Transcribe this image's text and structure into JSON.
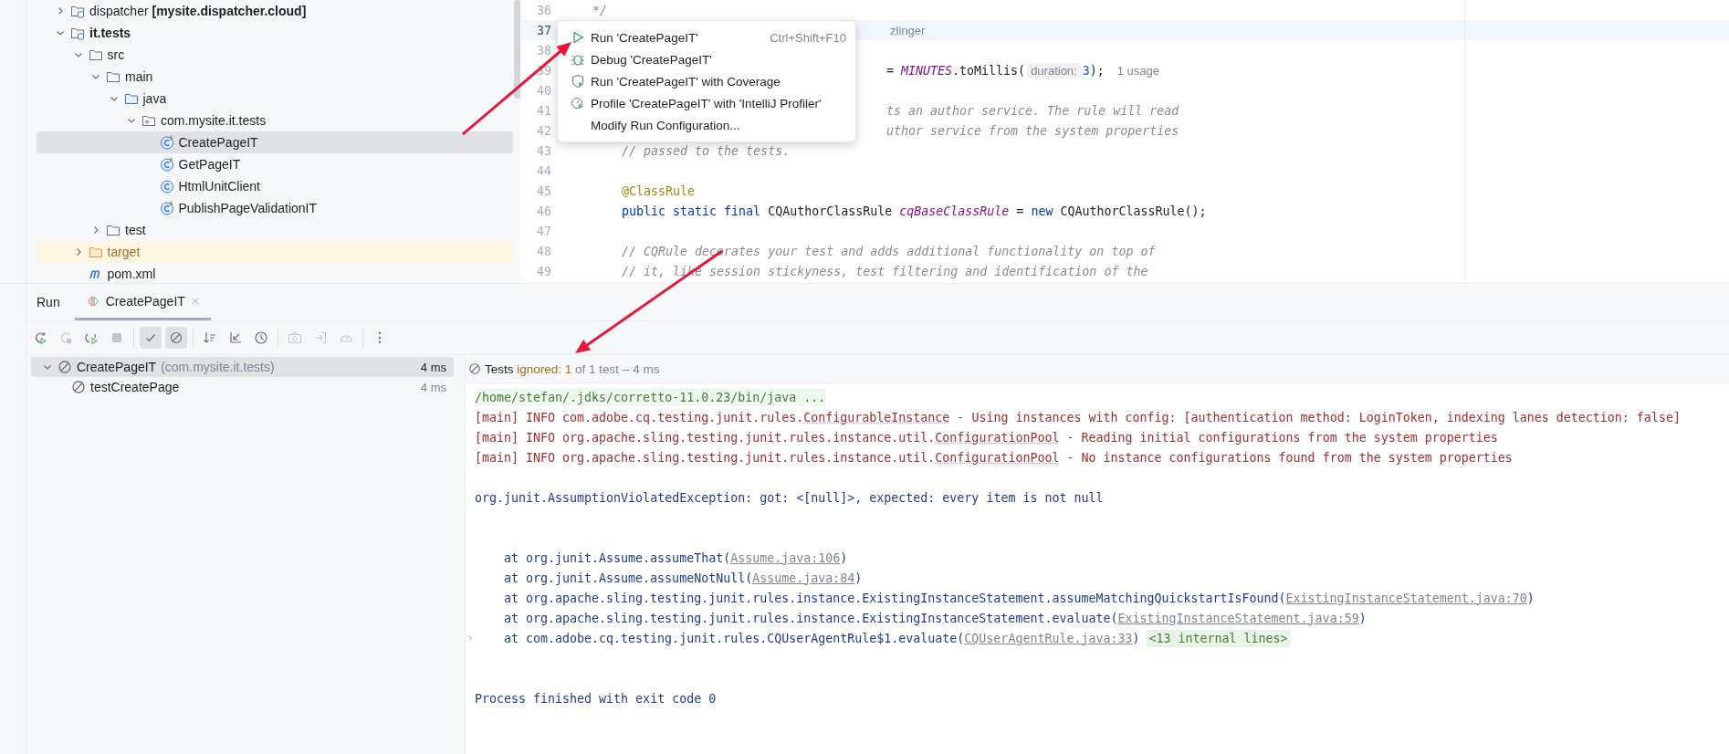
{
  "project_tree": [
    {
      "label": "dispatcher **[mysite.dispatcher.cloud]**",
      "kind": "module",
      "expanded": false,
      "selected": false
    },
    {
      "label": "**it.tests**",
      "kind": "module",
      "expanded": true,
      "selected": false,
      "children": [
        {
          "label": "src",
          "kind": "folder",
          "expanded": true,
          "selected": false,
          "children": [
            {
              "label": "main",
              "kind": "folder",
              "expanded": true,
              "selected": false,
              "children": [
                {
                  "label": "java",
                  "kind": "source-folder",
                  "expanded": true,
                  "selected": false,
                  "children": [
                    {
                      "label": "com.mysite.it.tests",
                      "kind": "package",
                      "expanded": true,
                      "selected": false,
                      "children": [
                        {
                          "label": "CreatePageIT",
                          "kind": "test-class",
                          "selected": true
                        },
                        {
                          "label": "GetPageIT",
                          "kind": "test-class",
                          "selected": false
                        },
                        {
                          "label": "HtmlUnitClient",
                          "kind": "class",
                          "selected": false
                        },
                        {
                          "label": "PublishPageValidationIT",
                          "kind": "test-class",
                          "selected": false
                        }
                      ]
                    }
                  ]
                }
              ]
            },
            {
              "label": "test",
              "kind": "folder",
              "expanded": false,
              "selected": false
            }
          ]
        },
        {
          "label": "target",
          "kind": "excluded-folder",
          "expanded": false,
          "selected": false
        },
        {
          "label": "pom.xml",
          "kind": "maven",
          "selected": false
        }
      ]
    }
  ],
  "editor": {
    "lines": [
      {
        "number": "36",
        "kind": "full",
        "current": false,
        "tokens": [
          {
            "text": "*/",
            "kind": "comment"
          }
        ]
      },
      {
        "number": "37",
        "kind": "after-popup",
        "current": true,
        "tokens": [
          {
            "text": "zlinger",
            "kind": "author"
          }
        ]
      },
      {
        "number": "38",
        "kind": "after-popup",
        "current": false
      },
      {
        "number": "39",
        "kind": "after-popup",
        "current": false,
        "tokens": [
          {
            "text": "= ",
            "kind": "plain"
          },
          {
            "text": "MINUTES",
            "kind": "field"
          },
          {
            "text": ".toMillis(",
            "kind": "plain"
          },
          {
            "text": "duration:",
            "kind": "hint"
          },
          {
            "text": "3",
            "kind": "number"
          },
          {
            "text": ");",
            "kind": "plain"
          },
          {
            "text": "1 usage",
            "kind": "usage"
          }
        ]
      },
      {
        "number": "40",
        "kind": "after-popup",
        "current": false
      },
      {
        "number": "41",
        "kind": "after-popup",
        "current": false,
        "tokens": [
          {
            "text": "ts an author service. The rule will read",
            "kind": "comment"
          }
        ]
      },
      {
        "number": "42",
        "kind": "after-popup",
        "current": false,
        "tokens": [
          {
            "text": "uthor service from the system properties",
            "kind": "comment"
          }
        ]
      },
      {
        "number": "43",
        "kind": "full",
        "current": false,
        "tokens": [
          {
            "text": "    // passed to the tests.",
            "kind": "comment"
          }
        ]
      },
      {
        "number": "44",
        "kind": "full",
        "current": false
      },
      {
        "number": "45",
        "kind": "full",
        "current": false,
        "tokens": [
          {
            "text": "    @ClassRule",
            "kind": "annotation"
          }
        ]
      },
      {
        "number": "46",
        "kind": "full",
        "current": false,
        "tokens": [
          {
            "text": "    public static final ",
            "kind": "keyword"
          },
          {
            "text": "CQAuthorClassRule ",
            "kind": "plain"
          },
          {
            "text": "cqBaseClassRule",
            "kind": "field"
          },
          {
            "text": " = ",
            "kind": "plain"
          },
          {
            "text": "new ",
            "kind": "keyword"
          },
          {
            "text": "CQAuthorClassRule();",
            "kind": "plain"
          }
        ]
      },
      {
        "number": "47",
        "kind": "full",
        "current": false
      },
      {
        "number": "48",
        "kind": "full",
        "current": false,
        "tokens": [
          {
            "text": "    // CQRule decorates your test and adds additional functionality on top of",
            "kind": "comment"
          }
        ]
      },
      {
        "number": "49",
        "kind": "full",
        "current": false,
        "tokens": [
          {
            "text": "    // it, like session stickyness, test filtering and identification of the",
            "kind": "comment"
          }
        ]
      }
    ]
  },
  "context_menu": [
    {
      "label": "Run 'CreatePageIT'",
      "kind": "run",
      "shortcut": "Ctrl+Shift+F10"
    },
    {
      "label": "Debug 'CreatePageIT'",
      "kind": "debug"
    },
    {
      "label": "Run 'CreatePageIT' with Coverage",
      "kind": "coverage"
    },
    {
      "label": "Profile 'CreatePageIT' with 'IntelliJ Profiler'",
      "kind": "profile"
    },
    {
      "label": "Modify Run Configuration...",
      "kind": "plain"
    }
  ],
  "run_panel": {
    "title": "Run",
    "tabs": [
      {
        "label": "CreatePageIT",
        "selected": true
      }
    ],
    "toolbar": [
      {
        "kind": "rerun",
        "disabled": false,
        "selected": false
      },
      {
        "kind": "rerun-failed",
        "disabled": true,
        "selected": false
      },
      {
        "kind": "toggle-auto",
        "disabled": false,
        "selected": false
      },
      {
        "kind": "stop",
        "disabled": true,
        "selected": false
      },
      {
        "kind": "show-passed",
        "disabled": false,
        "selected": true
      },
      {
        "kind": "show-ignored",
        "disabled": false,
        "selected": true
      },
      {
        "kind": "sort",
        "disabled": false,
        "selected": false
      },
      {
        "kind": "collapse",
        "disabled": false,
        "selected": false
      },
      {
        "kind": "history",
        "disabled": false,
        "selected": false
      },
      {
        "kind": "camera",
        "disabled": true,
        "selected": false
      },
      {
        "kind": "export",
        "disabled": true,
        "selected": false
      },
      {
        "kind": "gauge",
        "disabled": true,
        "selected": false
      },
      {
        "kind": "more",
        "disabled": false,
        "selected": false
      }
    ],
    "tests": [
      {
        "name": "CreatePageIT",
        "package": "(com.mysite.it.tests)",
        "time": "4 ms",
        "expanded": true,
        "selected": true,
        "children": [
          {
            "name": "testCreatePage",
            "time": "4 ms",
            "selected": false
          }
        ]
      }
    ],
    "status": {
      "label": "Tests",
      "ignored": "ignored: 1",
      "summary": "of 1 test – 4 ms"
    },
    "console": [
      {
        "kind": "command",
        "tokens": [
          {
            "text": "/home/stefan/.jdks/corretto-11.0.23/bin/java ...",
            "kind": "plain"
          }
        ]
      },
      {
        "kind": "log",
        "tokens": [
          {
            "text": "[main] INFO com.adobe.cq.testing.junit.rules.",
            "kind": "plain"
          },
          {
            "text": "ConfigurableInstance",
            "kind": "symbol"
          },
          {
            "text": " - Using instances with config: [authentication method: LoginToken, indexing lanes detection: false]",
            "kind": "plain"
          }
        ]
      },
      {
        "kind": "log",
        "tokens": [
          {
            "text": "[main] INFO org.apache.sling.testing.junit.rules.instance.util.",
            "kind": "plain"
          },
          {
            "text": "ConfigurationPool",
            "kind": "symbol"
          },
          {
            "text": " - Reading initial configurations from the system properties",
            "kind": "plain"
          }
        ]
      },
      {
        "kind": "log",
        "tokens": [
          {
            "text": "[main] INFO org.apache.sling.testing.junit.rules.instance.util.",
            "kind": "plain"
          },
          {
            "text": "ConfigurationPool",
            "kind": "symbol"
          },
          {
            "text": " - No instance configurations found from the system properties",
            "kind": "plain"
          }
        ]
      },
      {
        "kind": "blank"
      },
      {
        "kind": "error",
        "tokens": [
          {
            "text": "org.junit.AssumptionViolatedException: got: <[null]>, expected: every item is not null",
            "kind": "plain"
          }
        ]
      },
      {
        "kind": "blank"
      },
      {
        "kind": "blank"
      },
      {
        "kind": "stack",
        "folded": false,
        "tokens": [
          {
            "text": "at org.junit.Assume.assumeThat(",
            "kind": "plain"
          },
          {
            "text": "Assume.java:106",
            "kind": "link"
          },
          {
            "text": ")",
            "kind": "plain"
          }
        ]
      },
      {
        "kind": "stack",
        "folded": false,
        "tokens": [
          {
            "text": "at org.junit.Assume.assumeNotNull(",
            "kind": "plain"
          },
          {
            "text": "Assume.java:84",
            "kind": "link"
          },
          {
            "text": ")",
            "kind": "plain"
          }
        ]
      },
      {
        "kind": "stack",
        "folded": false,
        "tokens": [
          {
            "text": "at org.apache.sling.testing.junit.rules.instance.ExistingInstanceStatement.assumeMatchingQuickstartIsFound(",
            "kind": "plain"
          },
          {
            "text": "ExistingInstanceStatement.java:70",
            "kind": "link"
          },
          {
            "text": ")",
            "kind": "plain"
          }
        ]
      },
      {
        "kind": "stack",
        "folded": false,
        "tokens": [
          {
            "text": "at org.apache.sling.testing.junit.rules.instance.ExistingInstanceStatement.evaluate(",
            "kind": "plain"
          },
          {
            "text": "ExistingInstanceStatement.java:59",
            "kind": "link"
          },
          {
            "text": ")",
            "kind": "plain"
          }
        ]
      },
      {
        "kind": "stack",
        "folded": true,
        "tokens": [
          {
            "text": "at com.adobe.cq.testing.junit.rules.CQUserAgentRule$1.evaluate(",
            "kind": "plain"
          },
          {
            "text": "CQUserAgentRule.java:33",
            "kind": "link"
          },
          {
            "text": ") ",
            "kind": "plain"
          },
          {
            "text": "<13 internal lines>",
            "kind": "fold"
          }
        ]
      },
      {
        "kind": "blank"
      },
      {
        "kind": "blank"
      },
      {
        "kind": "process",
        "tokens": [
          {
            "text": "Process finished with exit code 0",
            "kind": "plain"
          }
        ]
      }
    ]
  },
  "annotations": [
    {
      "kind": "arrow"
    },
    {
      "kind": "arrow"
    }
  ]
}
